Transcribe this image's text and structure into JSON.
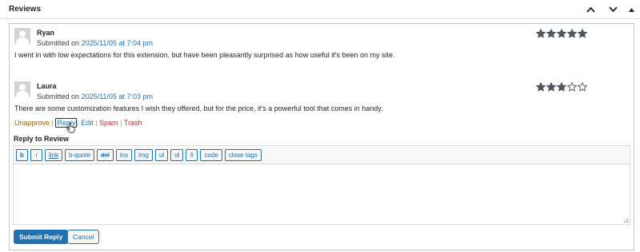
{
  "panel": {
    "title": "Reviews",
    "controls": [
      "chevron-up-icon",
      "chevron-down-icon",
      "caret-up-icon"
    ]
  },
  "reviews": [
    {
      "author": "Ryan",
      "submitted_prefix": "Submitted on",
      "date_link": "2025/11/05 at 7:04 pm",
      "rating": 5,
      "max_rating": 5,
      "content": "I went in with low expectations for this extension, but have been pleasantly surprised as how useful it's been on my site."
    },
    {
      "author": "Laura",
      "submitted_prefix": "Submitted on",
      "date_link": "2025/11/05 at 7:03 pm",
      "rating": 3,
      "max_rating": 5,
      "content": "There are some customization features I wish they offered, but for the price, it's a powerful tool that comes in handy."
    }
  ],
  "actions": {
    "unapprove": "Unapprove",
    "reply": "Reply",
    "edit": "Edit",
    "spam": "Spam",
    "trash": "Trash",
    "separator": "|"
  },
  "reply_form": {
    "label": "Reply to Review",
    "toolbar": [
      "b",
      "i",
      "link",
      "b-quote",
      "del",
      "ins",
      "img",
      "ul",
      "ol",
      "li",
      "code",
      "close tags"
    ],
    "textarea_value": "",
    "submit_label": "Submit Reply",
    "cancel_label": "Cancel"
  },
  "colors": {
    "link": "#2271b1",
    "unapprove": "#996800",
    "danger": "#b32d2e",
    "star": "#50575e",
    "primary_button": "#2271b1"
  }
}
